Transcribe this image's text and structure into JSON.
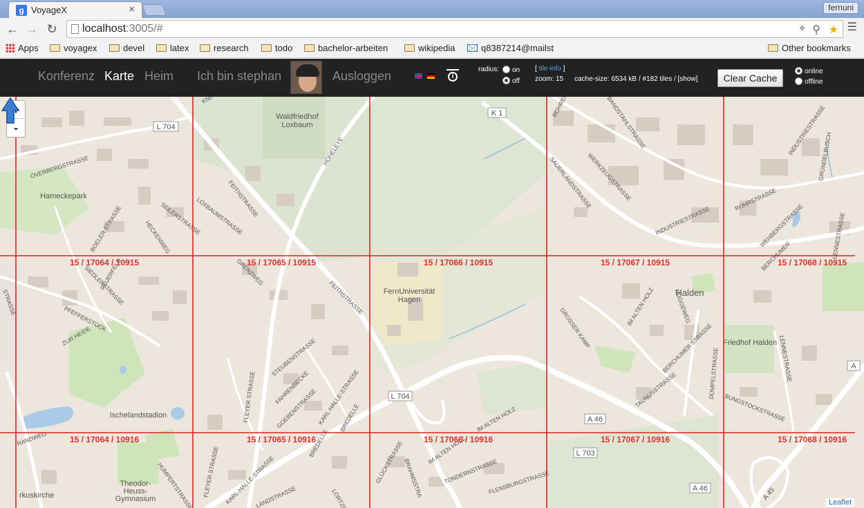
{
  "browser": {
    "tab_title": "VoyageX",
    "tab_close": "×",
    "tab_favicon": "g",
    "profile_name": "fernuni",
    "url_host": "localhost",
    "url_rest": ":3005/#"
  },
  "bookmarks": {
    "apps": "Apps",
    "items": [
      "voyagex",
      "devel",
      "latex",
      "research",
      "todo",
      "bachelor-arbeiten",
      "wikipedia"
    ],
    "mail": "q8387214@mailst",
    "other": "Other bookmarks"
  },
  "nav": {
    "konferenz": "Konferenz",
    "karte": "Karte",
    "heim": "Heim",
    "user": "Ich bin stephan",
    "logout": "Ausloggen"
  },
  "radius": {
    "label": "radius:",
    "on": "on",
    "off": "off",
    "selected": "off"
  },
  "tile_info": {
    "link_open": "[",
    "link": "tile-info",
    "link_close": "]",
    "zoom": "zoom: 15",
    "cache": "cache-size: 6534 kB / #182 tiles / [show]"
  },
  "clear_cache": "Clear Cache",
  "mode": {
    "online": "online",
    "offline": "offline",
    "selected": "online"
  },
  "map": {
    "zoom_in": "+",
    "zoom_out": "-",
    "attribution": "Leaflet",
    "tiles_row1": [
      "15 / 17064 / 10915",
      "15 / 17065 / 10915",
      "15 / 17066 / 10915",
      "15 / 17067 / 10915",
      "15 / 17068 / 10915"
    ],
    "tiles_row2": [
      "15 / 17064 / 10916",
      "15 / 17065 / 10916",
      "15 / 17066 / 10916",
      "15 / 17067 / 10916",
      "15 / 17068 / 10916"
    ],
    "places": {
      "waldfriedhof": "Waldfriedhof",
      "loxbaum": "Loxbaum",
      "hameckepark": "Hameckepark",
      "fernuni1": "FernUniversität",
      "fernuni2": "Hagen",
      "halden": "Halden",
      "friedhof_halden": "Friedhof Halden",
      "ischeland": "Ischelandstadion",
      "theodor1": "Theodor-",
      "theodor2": "Heuss-",
      "theodor3": "Gymnasium",
      "kuskirche": "rkuskirche"
    },
    "shields": {
      "l704a": "L 704",
      "k1": "K 1",
      "l704b": "L 704",
      "a46a": "A 46",
      "l703": "L 703",
      "a46b": "A 46",
      "a45": "A 45",
      "a_edge": "A"
    },
    "streets": {
      "overbergstrasse": "OVERBERGSTRASSE",
      "boeler": "BOELER STRASSE",
      "seiler": "SEILERSTRASSE",
      "hecken": "HECKENWEG",
      "siedler": "SIEDLERSTRASSE",
      "feuerfeld": "FEUERFELD",
      "pfeffer": "PFEFFERSTÜCK",
      "zurheide": "ZUR HEIDE",
      "feith1": "FEITHSTRASSE",
      "loxbaum": "LOXBAUMSTRASSE",
      "grenzweg": "GRENZWEG",
      "feith2": "FEITHSTRASSE",
      "hoheleye": "HOHELEYE",
      "knips": "KNIPS",
      "sauerland": "SAUERLANDSTRASSE",
      "werkzeug": "WERKZEUGSTRASSE",
      "bandstahl": "BANDSTAHLSTRASSE",
      "rohren": "ROHREN",
      "industrie1": "INDUSTRIESTRASSE",
      "industrie2": "INDUSTRIESTRASSE",
      "rohrstrasse": "ROHRSTRASSE",
      "webers": "WEHBERGSTRASSE",
      "grundel": "GRÜNDELBUSCH",
      "lennestrasse1": "LENNESTRASSE",
      "berchumer1": "BERCHUMER",
      "imaltenholz1": "IM ALTEN HOLZ",
      "ruggeweg": "RUGGEWEG",
      "grosserkamp": "GROSSER KAMP",
      "berchumer2": "BERCHUMER STRASSE",
      "taunus": "TAUNUSSTRASSE",
      "dumpel": "DÜMPELSTRASSE",
      "bungs": "BUNGSTOCKSTRASSE",
      "lennestrasse2": "LENNESTRASSE",
      "steuben": "STEUBENSTRASSE",
      "fahrenbecke": "FAHRENBECKE",
      "goeben": "GOEBENSTRASSE",
      "karlhalle1": "KARL-HALLE-STRASSE",
      "bredelle1": "BREDELLE",
      "fleyer1": "FLEYER STRASSE",
      "randweg": "RANDWEG",
      "humperts": "HUMPERTSTRASSE",
      "fleyer2": "FLEYER STRASSE",
      "karlhalle2": "KARL-HALLE-STRASSE",
      "landstrasse": "LANDSTRASSE",
      "bredelle2": "BREDELLE",
      "lortzing": "LORTZIN",
      "glueck": "GLÜCKSTRASSE",
      "brahms": "BRAHMSSTRA",
      "imaltenholz2": "IM ALTEN HOLZ",
      "imaltenholz3": "IM ALTEN HOLZ",
      "tonder": "TONDERNSTRASSE",
      "flensburg": "FLENSBURGSTRASSE",
      "strasse_edge": "STRASSE"
    }
  }
}
